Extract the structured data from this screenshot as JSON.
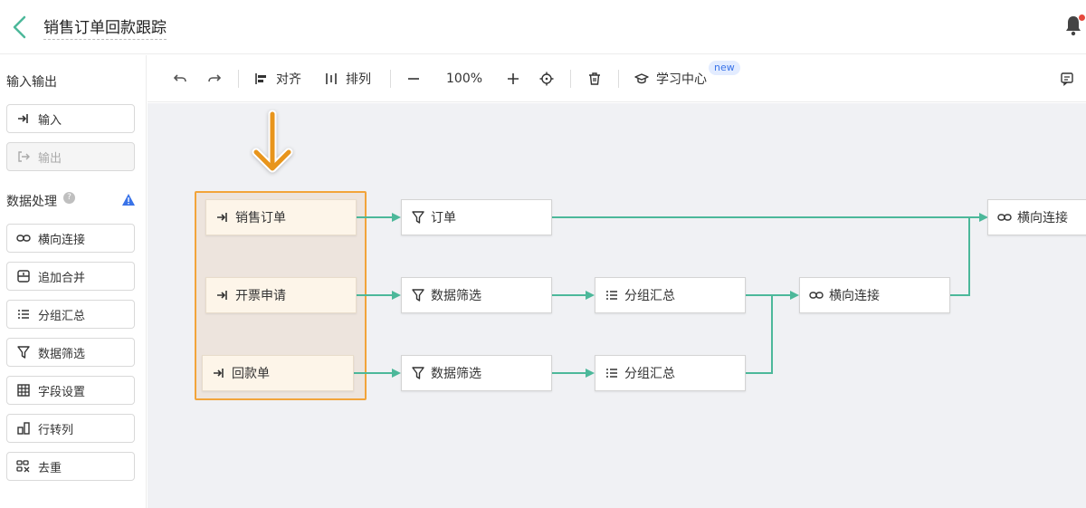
{
  "header": {
    "title": "销售订单回款跟踪"
  },
  "sidebar": {
    "io_section": "输入输出",
    "io_items": [
      {
        "label": "输入",
        "icon": "input-arrow-icon",
        "enabled": true
      },
      {
        "label": "输出",
        "icon": "output-arrow-icon",
        "enabled": false
      }
    ],
    "process_section": "数据处理",
    "process_items": [
      {
        "label": "横向连接",
        "icon": "link-icon"
      },
      {
        "label": "追加合并",
        "icon": "merge-icon"
      },
      {
        "label": "分组汇总",
        "icon": "list-icon"
      },
      {
        "label": "数据筛选",
        "icon": "filter-icon"
      },
      {
        "label": "字段设置",
        "icon": "table-icon"
      },
      {
        "label": "行转列",
        "icon": "row-to-column-icon"
      },
      {
        "label": "去重",
        "icon": "dedupe-icon"
      }
    ]
  },
  "toolbar": {
    "align": "对齐",
    "arrange": "排列",
    "zoom": "100%",
    "learn": "学习中心",
    "new_badge": "new"
  },
  "canvas": {
    "nodes": {
      "sales_order": "销售订单",
      "invoice_apply": "开票申请",
      "payment": "回款单",
      "order_filter": "订单",
      "filter_2": "数据筛选",
      "filter_3": "数据筛选",
      "group_2": "分组汇总",
      "group_3": "分组汇总",
      "join_1": "横向连接",
      "join_final": "横向连接"
    }
  },
  "colors": {
    "accent_green": "#4cb89a",
    "highlight_orange": "#f2a43a",
    "arrow_orange": "#e8951a"
  }
}
